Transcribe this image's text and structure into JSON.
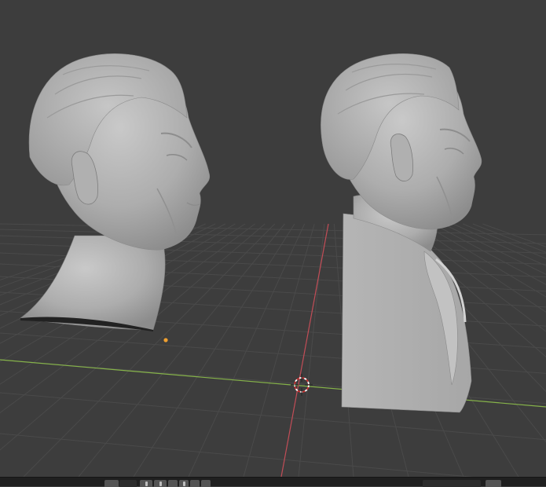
{
  "app": {
    "view": "3d-viewport",
    "background_color": "#3d3d3d",
    "grid_color": "#4a4a4a",
    "x_axis_color": "#86b34a",
    "y_axis_color": "#c24d57",
    "mesh_color": "#b9b9b9"
  },
  "objects": [
    {
      "name": "head-sculpt",
      "selected": false
    },
    {
      "name": "bust-sculpt",
      "selected": false
    }
  ],
  "icons": {
    "cursor": "3d-cursor-icon",
    "origin": "origin-point-icon"
  },
  "statusbar": {
    "buttons": 8
  }
}
